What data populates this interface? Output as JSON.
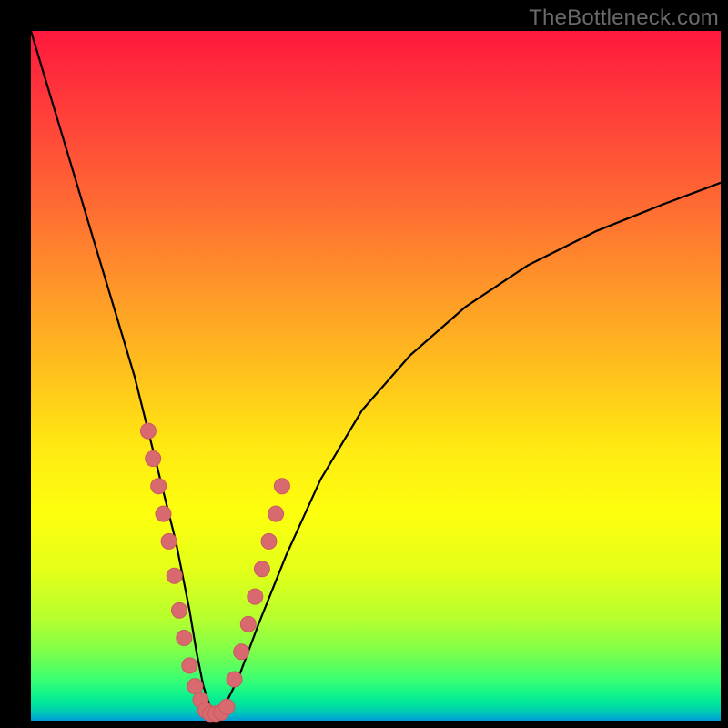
{
  "watermark": "TheBottleneck.com",
  "colors": {
    "gradient_top": "#ff183d",
    "gradient_bottom": "#0099d8",
    "curve": "#000000",
    "dots": "#d86a6f",
    "frame": "#000000"
  },
  "chart_data": {
    "type": "line",
    "title": "",
    "xlabel": "",
    "ylabel": "",
    "xlim": [
      0,
      100
    ],
    "ylim": [
      0,
      100
    ],
    "grid": false,
    "legend": false,
    "series": [
      {
        "name": "bottleneck-curve",
        "x": [
          0,
          3,
          6,
          9,
          12,
          15,
          17,
          19,
          21,
          23,
          24,
          25,
          26,
          27,
          28,
          30,
          33,
          37,
          42,
          48,
          55,
          63,
          72,
          82,
          92,
          100
        ],
        "y": [
          100,
          90,
          80,
          70,
          60,
          50,
          42,
          34,
          26,
          16,
          10,
          5,
          2,
          1,
          2,
          6,
          14,
          24,
          35,
          45,
          53,
          60,
          66,
          71,
          75,
          78
        ]
      }
    ],
    "annotations": {
      "dots_left_cluster": {
        "description": "points along descending arm near trough",
        "x": [
          17.0,
          17.7,
          18.5,
          19.2,
          20.0,
          20.8,
          21.5,
          22.2,
          23.0,
          23.8,
          24.6
        ],
        "y": [
          42,
          38,
          34,
          30,
          26,
          21,
          16,
          12,
          8,
          5,
          3
        ]
      },
      "dots_trough_cluster": {
        "description": "points at bottom of valley",
        "x": [
          25.3,
          26.0,
          26.8,
          27.6,
          28.4
        ],
        "y": [
          1.5,
          1.0,
          1.0,
          1.2,
          2.0
        ]
      },
      "dots_right_cluster": {
        "description": "points along ascending arm near trough",
        "x": [
          29.5,
          30.5,
          31.5,
          32.5,
          33.5,
          34.5,
          35.5,
          36.4
        ],
        "y": [
          6,
          10,
          14,
          18,
          22,
          26,
          30,
          34
        ]
      }
    }
  }
}
